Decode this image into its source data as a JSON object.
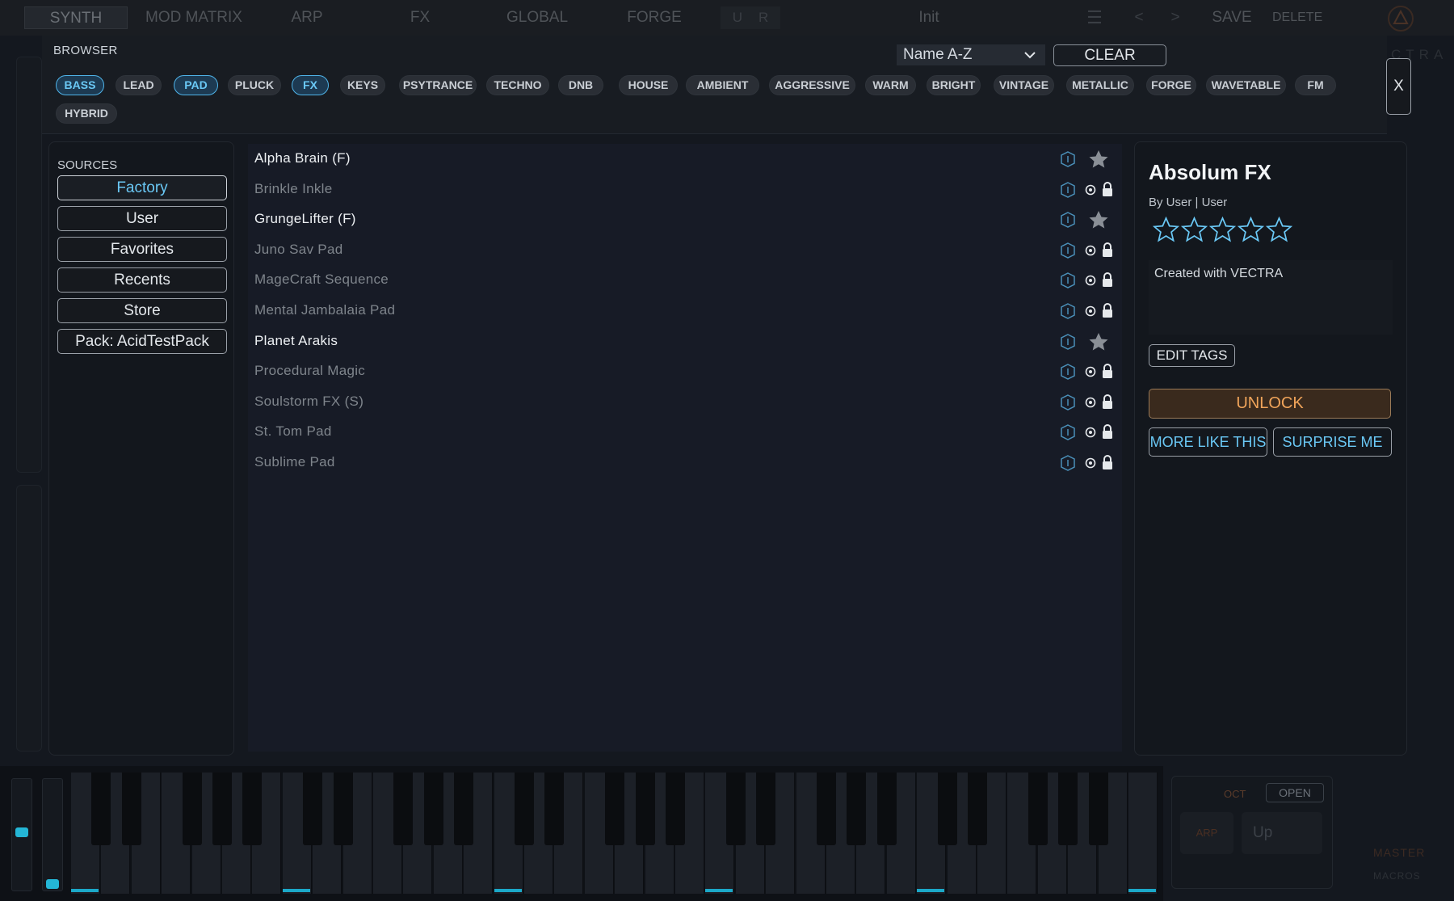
{
  "nav": {
    "tabs": [
      "SYNTH",
      "MOD MATRIX",
      "ARP",
      "FX",
      "GLOBAL",
      "FORGE"
    ],
    "undo": "U",
    "redo": "R",
    "preset_name": "Init",
    "save": "SAVE",
    "delete": "DELETE",
    "prev": "<",
    "next": ">"
  },
  "brand": {
    "logo_text": "CTRA"
  },
  "browser": {
    "title": "BROWSER",
    "sort_value": "Name A-Z",
    "clear_label": "CLEAR",
    "close_label": "X",
    "tags": [
      {
        "label": "BASS",
        "active": true
      },
      {
        "label": "LEAD",
        "active": false
      },
      {
        "label": "PAD",
        "active": true
      },
      {
        "label": "PLUCK",
        "active": false
      },
      {
        "label": "FX",
        "active": true
      },
      {
        "label": "KEYS",
        "active": false
      },
      {
        "label": "PSYTRANCE",
        "active": false
      },
      {
        "label": "TECHNO",
        "active": false
      },
      {
        "label": "DNB",
        "active": false
      },
      {
        "label": "HOUSE",
        "active": false
      },
      {
        "label": "AMBIENT",
        "active": false
      },
      {
        "label": "AGGRESSIVE",
        "active": false
      },
      {
        "label": "WARM",
        "active": false
      },
      {
        "label": "BRIGHT",
        "active": false
      },
      {
        "label": "VINTAGE",
        "active": false
      },
      {
        "label": "METALLIC",
        "active": false
      },
      {
        "label": "FORGE",
        "active": false
      },
      {
        "label": "WAVETABLE",
        "active": false
      },
      {
        "label": "FM",
        "active": false
      },
      {
        "label": "HYBRID",
        "active": false
      }
    ]
  },
  "sources": {
    "title": "SOURCES",
    "items": [
      {
        "label": "Factory",
        "active": true
      },
      {
        "label": "User",
        "active": false
      },
      {
        "label": "Favorites",
        "active": false
      },
      {
        "label": "Recents",
        "active": false
      },
      {
        "label": "Store",
        "active": false
      },
      {
        "label": "Pack: AcidTestPack",
        "active": false
      }
    ]
  },
  "presets": [
    {
      "name": "Alpha Brain (F)",
      "owned": true
    },
    {
      "name": "Brinkle Inkle",
      "owned": false
    },
    {
      "name": "GrungeLifter (F)",
      "owned": true
    },
    {
      "name": "Juno Sav Pad",
      "owned": false
    },
    {
      "name": "MageCraft Sequence",
      "owned": false
    },
    {
      "name": "Mental Jambalaia Pad",
      "owned": false
    },
    {
      "name": "Planet Arakis",
      "owned": true
    },
    {
      "name": "Procedural Magic",
      "owned": false
    },
    {
      "name": "Soulstorm FX (S)",
      "owned": false
    },
    {
      "name": "St. Tom Pad",
      "owned": false
    },
    {
      "name": "Sublime Pad",
      "owned": false
    }
  ],
  "detail": {
    "title": "Absolum FX",
    "author": "By User  |  User",
    "rating": 0,
    "rating_max": 5,
    "description": "Created with VECTRA",
    "edit_tags": "EDIT TAGS",
    "unlock": "UNLOCK",
    "more_like": "MORE LIKE THIS",
    "surprise": "SURPRISE ME"
  },
  "performance": {
    "oct_label": "OCT",
    "open_label": "OPEN",
    "arp_label": "ARP",
    "arp_mode": "Up",
    "master_label": "MASTER",
    "macros_label": "MACROS",
    "pitch_wheel": 0.5,
    "mod_wheel": 0.0
  },
  "colors": {
    "accent_blue": "#6ac8f5",
    "unlock_orange": "#f0a45a",
    "key_highlight": "#1ba8c8"
  }
}
